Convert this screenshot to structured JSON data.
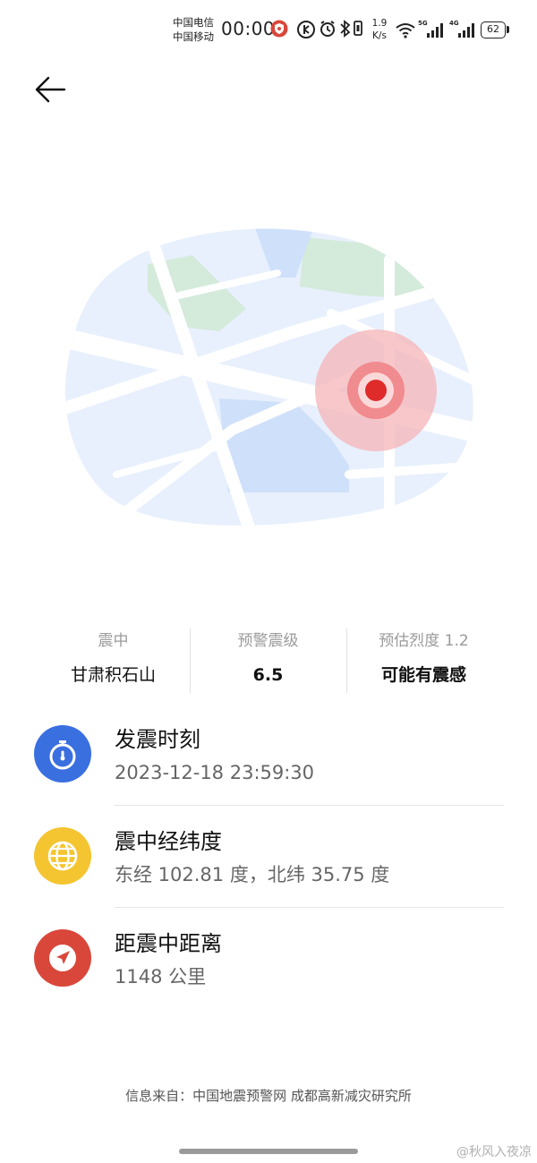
{
  "status_bar": {
    "carrier_1": "中国电信",
    "carrier_2": "中国移动",
    "time": "00:00",
    "speed_value": "1.9",
    "speed_unit": "K/s",
    "net_1": "5G",
    "net_2": "4G",
    "battery": "62",
    "icons": [
      "shield-icon",
      "data-saver-icon",
      "alarm-icon",
      "bluetooth-icon",
      "vibrate-icon",
      "wifi-icon",
      "signal-icon",
      "battery-icon"
    ]
  },
  "summary": {
    "epicenter_label": "震中",
    "epicenter_value": "甘肃积石山",
    "magnitude_label": "预警震级",
    "magnitude_value": "6.5",
    "intensity_label": "预估烈度 1.2",
    "intensity_value": "可能有震感"
  },
  "details": {
    "time_title": "发震时刻",
    "time_value": "2023-12-18 23:59:30",
    "coord_title": "震中经纬度",
    "coord_value": "东经 102.81 度，北纬 35.75 度",
    "distance_title": "距震中距离",
    "distance_value": "1148 公里"
  },
  "source": "信息来自：中国地震预警网 成都高新减灾研究所",
  "watermark": "@秋风入夜凉",
  "colors": {
    "time_icon": "#3a6fe0",
    "coord_icon": "#f4c531",
    "distance_icon": "#d9473b",
    "epicenter_dot": "#e02b2b"
  }
}
